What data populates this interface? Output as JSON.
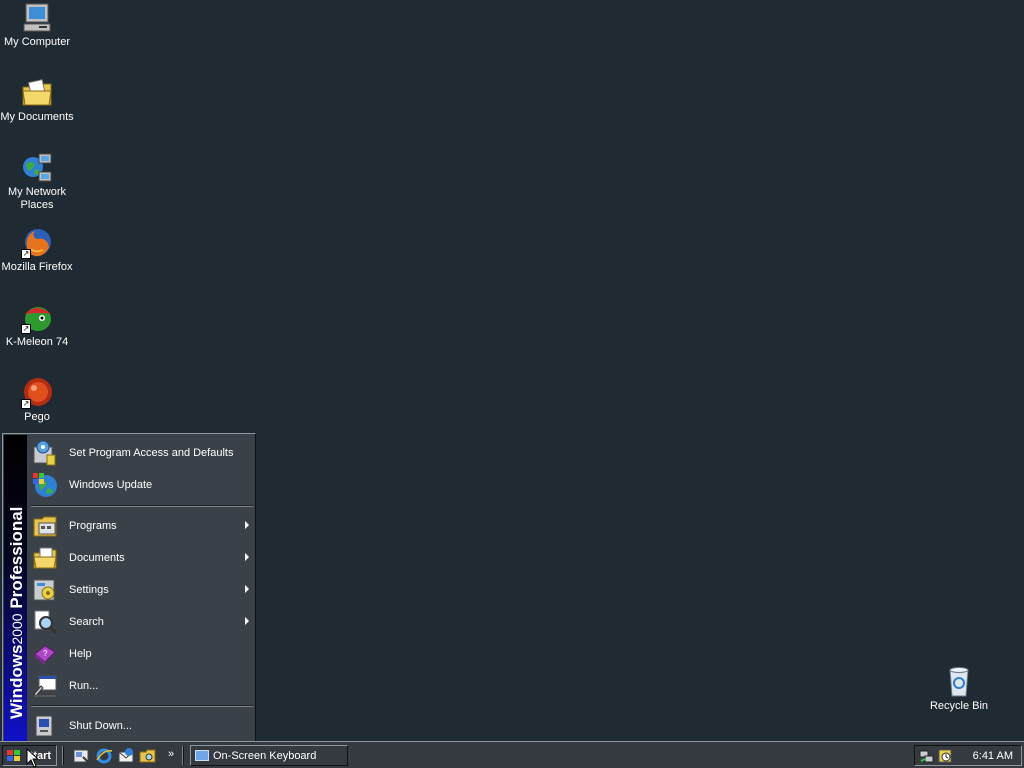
{
  "desktop": {
    "icons": [
      {
        "label": "My Computer",
        "icon": "my-computer-icon"
      },
      {
        "label": "My Documents",
        "icon": "my-documents-icon"
      },
      {
        "label": "My Network Places",
        "icon": "network-places-icon"
      },
      {
        "label": "Mozilla Firefox",
        "icon": "firefox-icon"
      },
      {
        "label": "K-Meleon 74",
        "icon": "k-meleon-icon"
      },
      {
        "label": "Pego",
        "icon": "pego-icon"
      },
      {
        "label": "Recycle Bin",
        "icon": "recycle-bin-icon"
      }
    ],
    "background_color": "#1f2a32"
  },
  "start_menu": {
    "banner": {
      "bold": "Windows",
      "thin": "2000",
      "edition": "Professional"
    },
    "items": [
      {
        "label": "Set Program Access and Defaults",
        "icon": "program-access-icon",
        "submenu": false
      },
      {
        "label": "Windows Update",
        "icon": "windows-update-icon",
        "submenu": false
      },
      {
        "label": "Programs",
        "icon": "programs-folder-icon",
        "submenu": true
      },
      {
        "label": "Documents",
        "icon": "documents-folder-icon",
        "submenu": true
      },
      {
        "label": "Settings",
        "icon": "settings-icon",
        "submenu": true
      },
      {
        "label": "Search",
        "icon": "search-icon",
        "submenu": true
      },
      {
        "label": "Help",
        "icon": "help-book-icon",
        "submenu": false
      },
      {
        "label": "Run...",
        "icon": "run-icon",
        "submenu": false
      },
      {
        "label": "Shut Down...",
        "icon": "shutdown-icon",
        "submenu": false
      }
    ]
  },
  "taskbar": {
    "start_label": "Start",
    "quick_launch_more": "»",
    "tasks": [
      {
        "label": "On-Screen Keyboard",
        "icon": "keyboard-icon"
      }
    ],
    "tray": {
      "clock": "6:41 AM"
    }
  }
}
